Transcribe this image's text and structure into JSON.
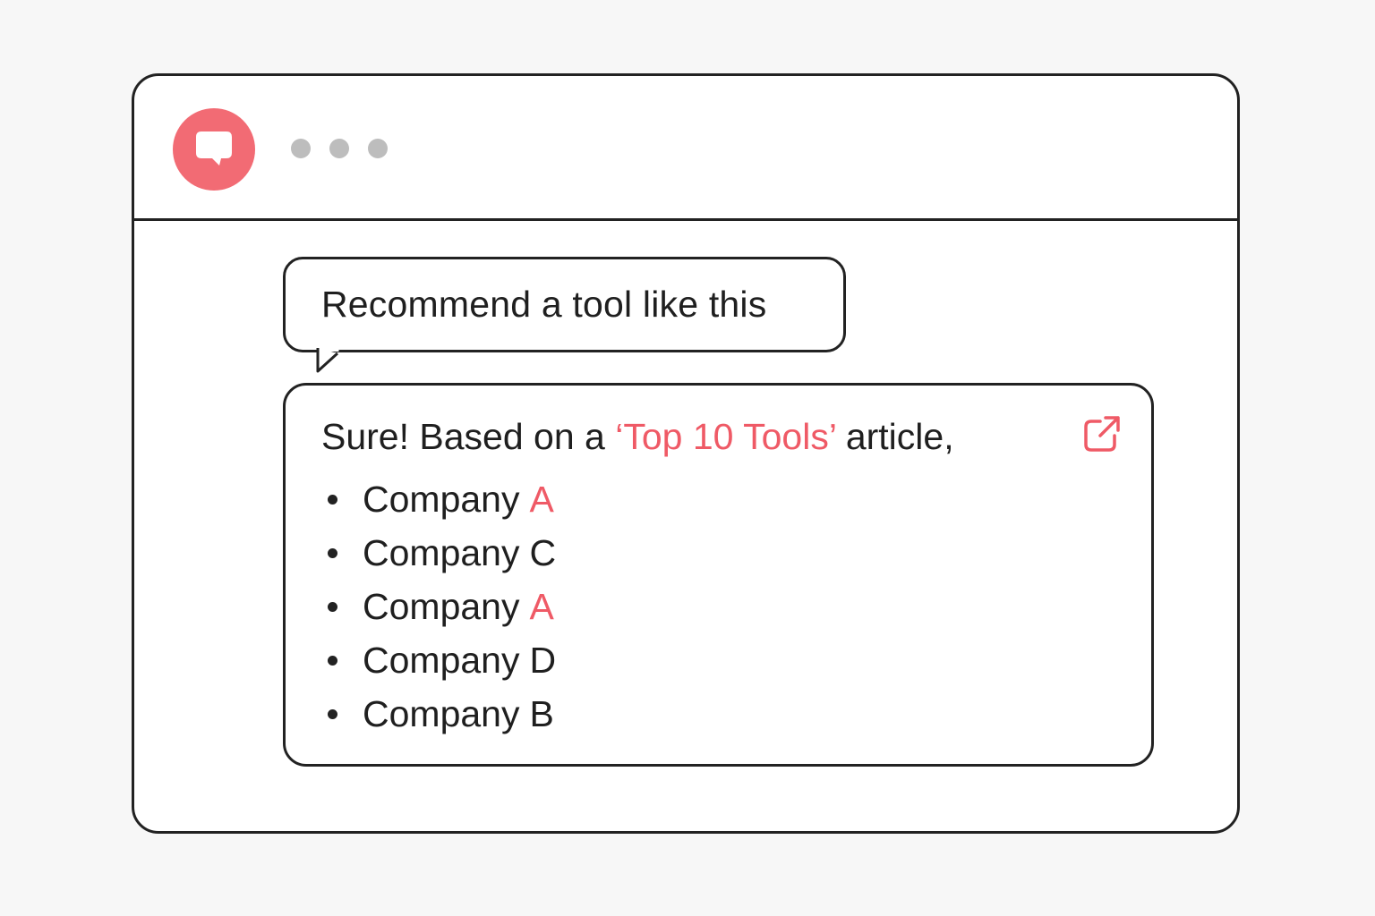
{
  "colors": {
    "accent": "#ef5a66",
    "border": "#222222",
    "dot": "#bdbdbd"
  },
  "titlebar": {
    "app_icon": "chat-bubble-icon",
    "window_dots": [
      "dot",
      "dot",
      "dot"
    ]
  },
  "user_message": {
    "text": "Recommend a tool like this"
  },
  "assistant_reply": {
    "intro_before": "Sure! Based on a",
    "intro_source": "‘Top 10 Tools’",
    "intro_after": "article,",
    "link_icon": "external-link-icon",
    "items": [
      {
        "name": "Company",
        "letter": "A",
        "highlight": true
      },
      {
        "name": "Company",
        "letter": "C",
        "highlight": false
      },
      {
        "name": "Company",
        "letter": "A",
        "highlight": true
      },
      {
        "name": "Company",
        "letter": "D",
        "highlight": false
      },
      {
        "name": "Company",
        "letter": "B",
        "highlight": false
      }
    ]
  }
}
